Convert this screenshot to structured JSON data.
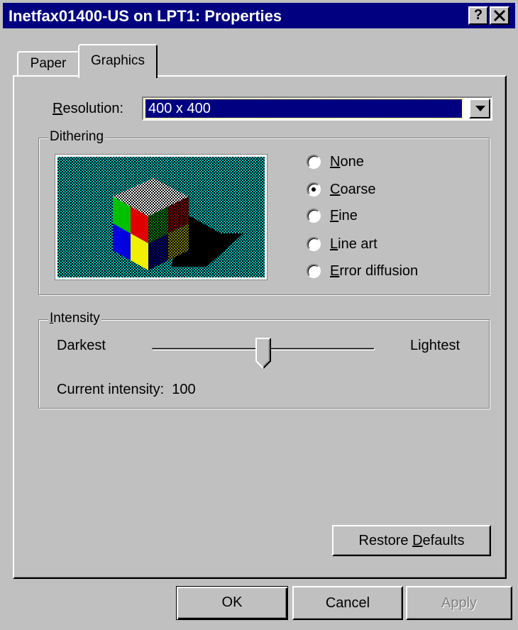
{
  "window": {
    "title": "Inetfax01400-US on LPT1: Properties",
    "help_button": "?",
    "close_button": "✕"
  },
  "tabs": [
    {
      "label": "Paper",
      "selected": false
    },
    {
      "label": "Graphics",
      "selected": true
    }
  ],
  "resolution": {
    "label_prefix": "",
    "label_mnemonic": "R",
    "label_rest": "esolution:",
    "value": "400 x 400"
  },
  "dithering": {
    "group_label": "Dithering",
    "options": [
      {
        "mnemonic": "N",
        "rest": "one",
        "selected": false
      },
      {
        "mnemonic": "C",
        "rest": "oarse",
        "selected": true
      },
      {
        "mnemonic": "F",
        "rest": "ine",
        "selected": false
      },
      {
        "mnemonic": "L",
        "rest": "ine art",
        "selected": false
      },
      {
        "mnemonic": "E",
        "rest": "rror diffusion",
        "selected": false
      }
    ]
  },
  "intensity": {
    "group_mnemonic": "I",
    "group_rest": "ntensity",
    "min_label": "Darkest",
    "max_label": "Lightest",
    "current_label": "Current intensity:",
    "current_value": "100",
    "slider_fraction": 0.5
  },
  "buttons": {
    "restore_prefix": "Restore ",
    "restore_mnemonic": "D",
    "restore_rest": "efaults",
    "ok": "OK",
    "cancel": "Cancel",
    "apply": "Apply"
  },
  "colors": {
    "title_bar": "#000080",
    "face": "#c0c0c0",
    "preview_background": "#00c0c0"
  }
}
